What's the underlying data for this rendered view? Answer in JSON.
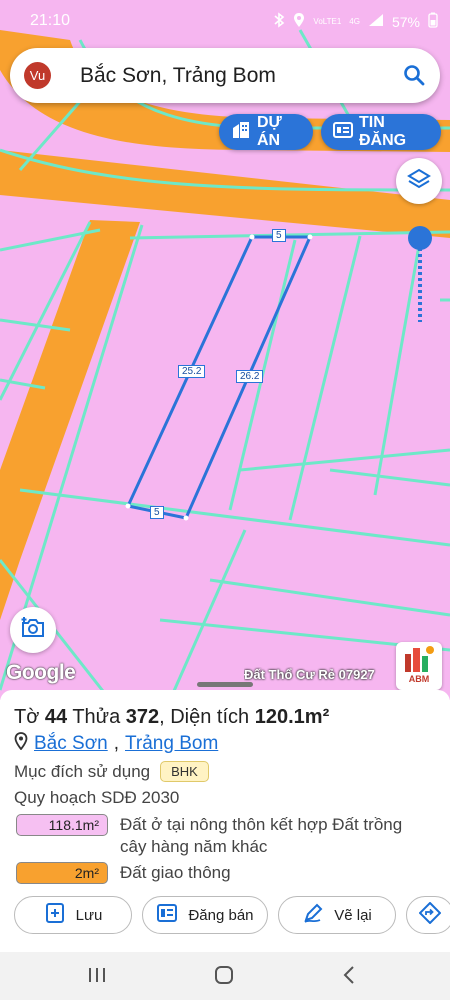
{
  "status_bar": {
    "time": "21:10",
    "network_line1": "VoLTE1",
    "network_type": "4G",
    "battery": "57%"
  },
  "search": {
    "avatar_initials": "Vu",
    "query": "Bắc Sơn, Trảng Bom",
    "icon": "search-icon"
  },
  "top_buttons": {
    "du_an_label": "DỰ ÁN",
    "tin_dang_label": "TIN ĐĂNG"
  },
  "map": {
    "edge_labels": [
      "5",
      "25.2",
      "26.2",
      "5"
    ],
    "colors": {
      "residential": "#f6b6f0",
      "road": "#f8a12f",
      "boundary": "#6ee8c8",
      "parcel_outline": "#2b74d8"
    },
    "watermark": "Đất Thổ Cư Rẻ 07927",
    "attribution": "Google",
    "brand_logo_text": "ABM"
  },
  "parcel": {
    "prefix_to": "Tờ ",
    "to_number": "44",
    "prefix_thua": " Thửa ",
    "thua_number": "372",
    "prefix_area": ", Diện tích ",
    "area": "120.1m²",
    "ward": "Bắc Sơn",
    "district": "Trảng Bom",
    "purpose_label": "Mục đích sử dụng",
    "purpose_code": "BHK",
    "plan_label": "Quy hoạch SDĐ 2030",
    "zones": [
      {
        "area": "118.1m²",
        "desc": "Đất ở tại nông thôn kết hợp Đất trồng cây hàng năm khác",
        "color": "#f6c0f2"
      },
      {
        "area": "2m²",
        "desc": "Đất giao thông",
        "color": "#f8a12f"
      }
    ]
  },
  "actions": {
    "save_label": "Lưu",
    "sell_label": "Đăng bán",
    "redraw_label": "Vẽ lại"
  }
}
